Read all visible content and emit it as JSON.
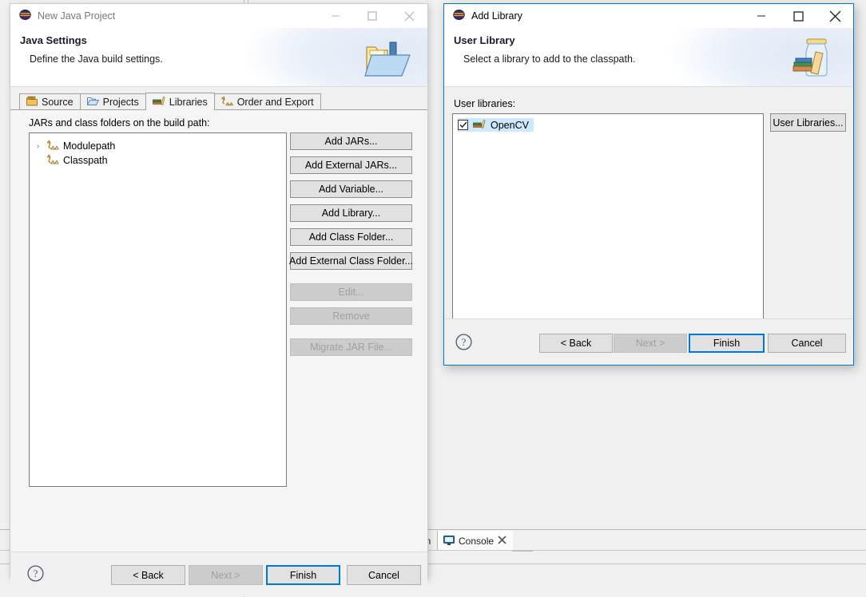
{
  "workbench": {
    "background_color": "#f0f0f0",
    "tabs": [
      {
        "label": "on",
        "icon": "clipped-tab-label",
        "active": false
      },
      {
        "label": "Console",
        "icon": "console-monitor-icon",
        "active": true,
        "close_icon": "close-x-icon"
      }
    ]
  },
  "new_java_project_dialog": {
    "window_title": "New Java Project",
    "window_icon": "eclipse-icon",
    "active": false,
    "window_buttons": {
      "minimize": "minimize-icon",
      "maximize": "maximize-icon",
      "close": "close-icon"
    },
    "banner": {
      "title": "Java Settings",
      "subtitle": "Define the Java build settings.",
      "icon": "java-folder-banner-icon"
    },
    "tabs": [
      {
        "label": "Source",
        "icon": "source-folder-icon",
        "selected": false
      },
      {
        "label": "Projects",
        "icon": "projects-folder-icon",
        "selected": false
      },
      {
        "label": "Libraries",
        "icon": "libraries-books-icon",
        "selected": true
      },
      {
        "label": "Order and Export",
        "icon": "order-export-icon",
        "selected": false
      }
    ],
    "tree_label": "JARs and class folders on the build path:",
    "tree_items": [
      {
        "label": "Modulepath",
        "icon": "classpath-icon",
        "has_twisty": true,
        "twisty": "›"
      },
      {
        "label": "Classpath",
        "icon": "classpath-icon",
        "has_twisty": false,
        "twisty": ""
      }
    ],
    "side_buttons": [
      {
        "label": "Add JARs...",
        "enabled": true
      },
      {
        "label": "Add External JARs...",
        "enabled": true
      },
      {
        "label": "Add Variable...",
        "enabled": true
      },
      {
        "label": "Add Library...",
        "enabled": true
      },
      {
        "label": "Add Class Folder...",
        "enabled": true
      },
      {
        "label": "Add External Class Folder...",
        "enabled": true
      },
      {
        "label": "Edit...",
        "enabled": false
      },
      {
        "label": "Remove",
        "enabled": false
      },
      {
        "label": "Migrate JAR File...",
        "enabled": false
      }
    ],
    "footer": {
      "help": "help-icon",
      "back": "< Back",
      "next": "Next >",
      "finish": "Finish",
      "cancel": "Cancel",
      "back_enabled": true,
      "next_enabled": false,
      "finish_is_default": true
    }
  },
  "add_library_dialog": {
    "window_title": "Add Library",
    "window_icon": "eclipse-icon",
    "active": true,
    "window_buttons": {
      "minimize": "minimize-icon",
      "maximize": "maximize-icon",
      "close": "close-icon"
    },
    "banner": {
      "title": "User Library",
      "subtitle": "Select a library to add to the classpath.",
      "icon": "jar-books-banner-icon"
    },
    "list_label": "User libraries:",
    "libraries": [
      {
        "label": "OpenCV",
        "checked": true,
        "selected": true,
        "icon": "library-books-icon"
      }
    ],
    "user_libraries_button": "User Libraries...",
    "footer": {
      "help": "help-icon",
      "back": "< Back",
      "next": "Next >",
      "finish": "Finish",
      "cancel": "Cancel",
      "back_enabled": true,
      "next_enabled": false,
      "finish_is_default": true
    }
  },
  "colors": {
    "accent": "#0078d7",
    "selection": "#cde8ff",
    "dialog_bg": "#f0f0f0",
    "button_bg": "#e1e1e1"
  }
}
